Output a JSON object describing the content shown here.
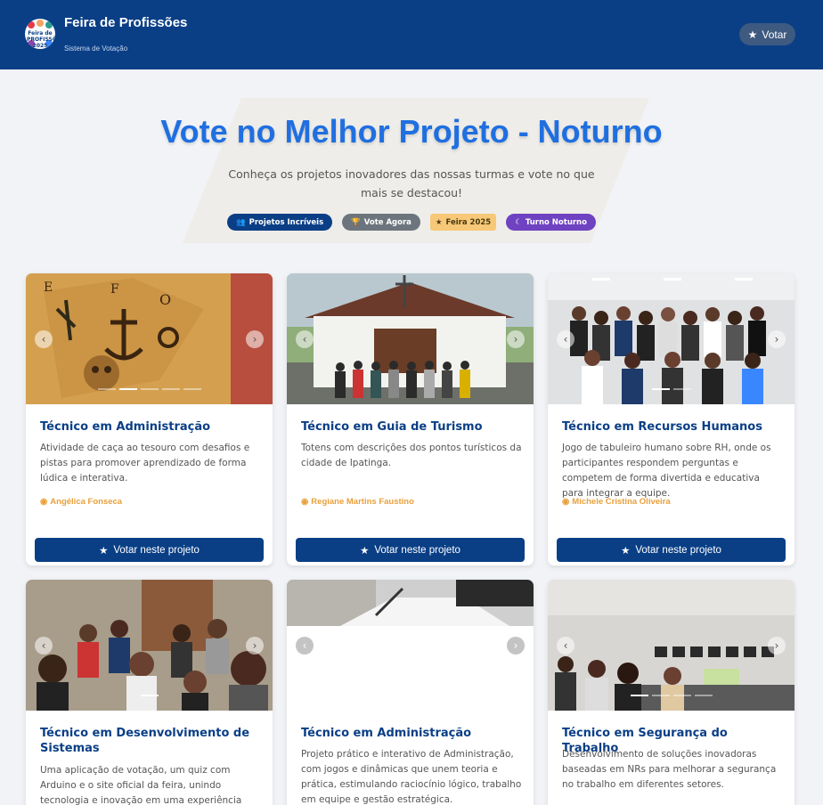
{
  "header": {
    "title": "Feira de Profissões",
    "subtitle": "Sistema de Votação",
    "logo_text": "Feira de PROFISSÕES 2025",
    "vote_label": "Votar"
  },
  "hero": {
    "title": "Vote no Melhor Projeto - Noturno",
    "subtitle": "Conheça os projetos inovadores das nossas turmas e vote no que mais se destacou!",
    "badges": [
      "Projetos Incríveis",
      "Vote Agora",
      "Feira 2025",
      "Turno Noturno"
    ]
  },
  "vote_button_label": "Votar neste projeto",
  "cards": [
    {
      "title": "Técnico em Administração",
      "description": "Atividade de caça ao tesouro com desafios e pistas para promover aprendizado de forma lúdica e interativa.",
      "author": "Angélica Fonseca",
      "slides": 5,
      "active_slide": 1
    },
    {
      "title": "Técnico em Guia de Turismo",
      "description": "Totens com descrições dos pontos turísticos da cidade de Ipatinga.",
      "author": "Regiane Martins Faustino",
      "slides": 1,
      "active_slide": 0
    },
    {
      "title": "Técnico em Recursos Humanos",
      "description": "Jogo de tabuleiro humano sobre RH, onde os participantes respondem perguntas e competem de forma divertida e educativa para integrar a equipe.",
      "author": "Michele Cristina Oliveira",
      "slides": 2,
      "active_slide": 0
    },
    {
      "title": "Técnico em Desenvolvimento de Sistemas",
      "description": "Uma aplicação de votação, um quiz com Arduino e o site oficial da feira, unindo tecnologia e inovação em uma experiência interativa.",
      "author": "",
      "slides": 1,
      "active_slide": 0
    },
    {
      "title": "Técnico em Administração",
      "description": "Projeto prático e interativo de Administração, com jogos e dinâmicas que unem teoria e prática, estimulando raciocínio lógico, trabalho em equipe e gestão estratégica.",
      "author": "",
      "slides": 0,
      "active_slide": 0
    },
    {
      "title": "Técnico em Segurança do Trabalho",
      "description": "Desenvolvimento de soluções inovadoras baseadas em NRs para melhorar a segurança no trabalho em diferentes setores.",
      "author": "",
      "slides": 4,
      "active_slide": 0
    }
  ],
  "colors": {
    "primary": "#0a3f86",
    "hero_title": "#1f6fe0",
    "author": "#e9a03b",
    "badge_purple": "#6f42c1",
    "badge_yellow": "#f7c877"
  }
}
